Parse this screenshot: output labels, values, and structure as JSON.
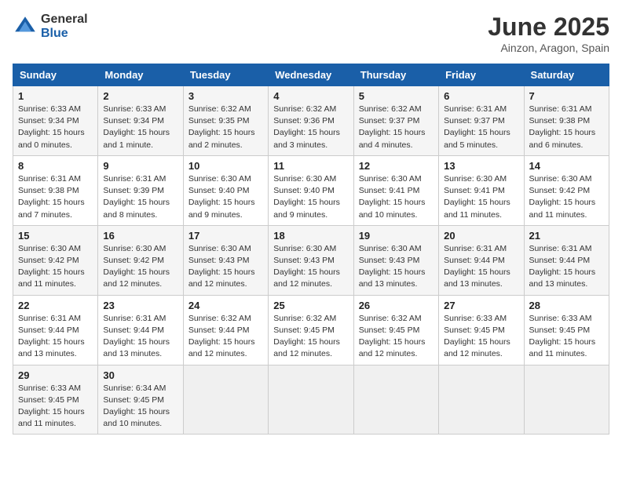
{
  "logo": {
    "general": "General",
    "blue": "Blue"
  },
  "title": "June 2025",
  "subtitle": "Ainzon, Aragon, Spain",
  "days_header": [
    "Sunday",
    "Monday",
    "Tuesday",
    "Wednesday",
    "Thursday",
    "Friday",
    "Saturday"
  ],
  "weeks": [
    [
      {
        "day": "1",
        "sunrise": "6:33 AM",
        "sunset": "9:34 PM",
        "daylight": "15 hours and 0 minutes."
      },
      {
        "day": "2",
        "sunrise": "6:33 AM",
        "sunset": "9:34 PM",
        "daylight": "15 hours and 1 minute."
      },
      {
        "day": "3",
        "sunrise": "6:32 AM",
        "sunset": "9:35 PM",
        "daylight": "15 hours and 2 minutes."
      },
      {
        "day": "4",
        "sunrise": "6:32 AM",
        "sunset": "9:36 PM",
        "daylight": "15 hours and 3 minutes."
      },
      {
        "day": "5",
        "sunrise": "6:32 AM",
        "sunset": "9:37 PM",
        "daylight": "15 hours and 4 minutes."
      },
      {
        "day": "6",
        "sunrise": "6:31 AM",
        "sunset": "9:37 PM",
        "daylight": "15 hours and 5 minutes."
      },
      {
        "day": "7",
        "sunrise": "6:31 AM",
        "sunset": "9:38 PM",
        "daylight": "15 hours and 6 minutes."
      }
    ],
    [
      {
        "day": "8",
        "sunrise": "6:31 AM",
        "sunset": "9:38 PM",
        "daylight": "15 hours and 7 minutes."
      },
      {
        "day": "9",
        "sunrise": "6:31 AM",
        "sunset": "9:39 PM",
        "daylight": "15 hours and 8 minutes."
      },
      {
        "day": "10",
        "sunrise": "6:30 AM",
        "sunset": "9:40 PM",
        "daylight": "15 hours and 9 minutes."
      },
      {
        "day": "11",
        "sunrise": "6:30 AM",
        "sunset": "9:40 PM",
        "daylight": "15 hours and 9 minutes."
      },
      {
        "day": "12",
        "sunrise": "6:30 AM",
        "sunset": "9:41 PM",
        "daylight": "15 hours and 10 minutes."
      },
      {
        "day": "13",
        "sunrise": "6:30 AM",
        "sunset": "9:41 PM",
        "daylight": "15 hours and 11 minutes."
      },
      {
        "day": "14",
        "sunrise": "6:30 AM",
        "sunset": "9:42 PM",
        "daylight": "15 hours and 11 minutes."
      }
    ],
    [
      {
        "day": "15",
        "sunrise": "6:30 AM",
        "sunset": "9:42 PM",
        "daylight": "15 hours and 11 minutes."
      },
      {
        "day": "16",
        "sunrise": "6:30 AM",
        "sunset": "9:42 PM",
        "daylight": "15 hours and 12 minutes."
      },
      {
        "day": "17",
        "sunrise": "6:30 AM",
        "sunset": "9:43 PM",
        "daylight": "15 hours and 12 minutes."
      },
      {
        "day": "18",
        "sunrise": "6:30 AM",
        "sunset": "9:43 PM",
        "daylight": "15 hours and 12 minutes."
      },
      {
        "day": "19",
        "sunrise": "6:30 AM",
        "sunset": "9:43 PM",
        "daylight": "15 hours and 13 minutes."
      },
      {
        "day": "20",
        "sunrise": "6:31 AM",
        "sunset": "9:44 PM",
        "daylight": "15 hours and 13 minutes."
      },
      {
        "day": "21",
        "sunrise": "6:31 AM",
        "sunset": "9:44 PM",
        "daylight": "15 hours and 13 minutes."
      }
    ],
    [
      {
        "day": "22",
        "sunrise": "6:31 AM",
        "sunset": "9:44 PM",
        "daylight": "15 hours and 13 minutes."
      },
      {
        "day": "23",
        "sunrise": "6:31 AM",
        "sunset": "9:44 PM",
        "daylight": "15 hours and 13 minutes."
      },
      {
        "day": "24",
        "sunrise": "6:32 AM",
        "sunset": "9:44 PM",
        "daylight": "15 hours and 12 minutes."
      },
      {
        "day": "25",
        "sunrise": "6:32 AM",
        "sunset": "9:45 PM",
        "daylight": "15 hours and 12 minutes."
      },
      {
        "day": "26",
        "sunrise": "6:32 AM",
        "sunset": "9:45 PM",
        "daylight": "15 hours and 12 minutes."
      },
      {
        "day": "27",
        "sunrise": "6:33 AM",
        "sunset": "9:45 PM",
        "daylight": "15 hours and 12 minutes."
      },
      {
        "day": "28",
        "sunrise": "6:33 AM",
        "sunset": "9:45 PM",
        "daylight": "15 hours and 11 minutes."
      }
    ],
    [
      {
        "day": "29",
        "sunrise": "6:33 AM",
        "sunset": "9:45 PM",
        "daylight": "15 hours and 11 minutes."
      },
      {
        "day": "30",
        "sunrise": "6:34 AM",
        "sunset": "9:45 PM",
        "daylight": "15 hours and 10 minutes."
      },
      null,
      null,
      null,
      null,
      null
    ]
  ]
}
